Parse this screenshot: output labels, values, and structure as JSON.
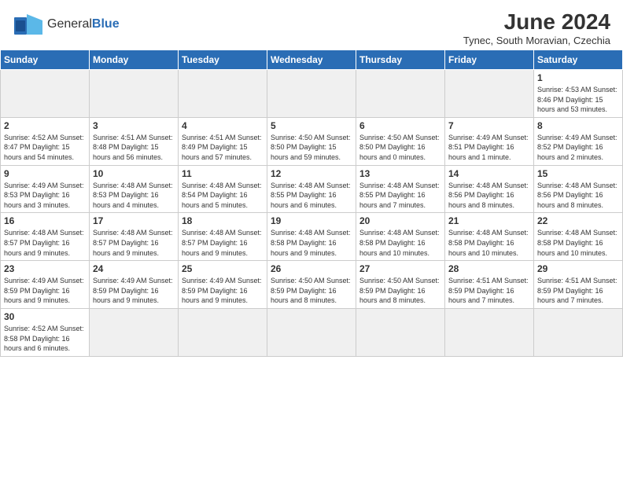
{
  "header": {
    "month_title": "June 2024",
    "location": "Tynec, South Moravian, Czechia",
    "logo_general": "General",
    "logo_blue": "Blue"
  },
  "days_of_week": [
    "Sunday",
    "Monday",
    "Tuesday",
    "Wednesday",
    "Thursday",
    "Friday",
    "Saturday"
  ],
  "weeks": [
    [
      {
        "day": "",
        "info": "",
        "empty": true
      },
      {
        "day": "",
        "info": "",
        "empty": true
      },
      {
        "day": "",
        "info": "",
        "empty": true
      },
      {
        "day": "",
        "info": "",
        "empty": true
      },
      {
        "day": "",
        "info": "",
        "empty": true
      },
      {
        "day": "",
        "info": "",
        "empty": true
      },
      {
        "day": "1",
        "info": "Sunrise: 4:53 AM\nSunset: 8:46 PM\nDaylight: 15 hours and 53 minutes."
      }
    ],
    [
      {
        "day": "2",
        "info": "Sunrise: 4:52 AM\nSunset: 8:47 PM\nDaylight: 15 hours and 54 minutes."
      },
      {
        "day": "3",
        "info": "Sunrise: 4:51 AM\nSunset: 8:48 PM\nDaylight: 15 hours and 56 minutes."
      },
      {
        "day": "4",
        "info": "Sunrise: 4:51 AM\nSunset: 8:49 PM\nDaylight: 15 hours and 57 minutes."
      },
      {
        "day": "5",
        "info": "Sunrise: 4:50 AM\nSunset: 8:50 PM\nDaylight: 15 hours and 59 minutes."
      },
      {
        "day": "6",
        "info": "Sunrise: 4:50 AM\nSunset: 8:50 PM\nDaylight: 16 hours and 0 minutes."
      },
      {
        "day": "7",
        "info": "Sunrise: 4:49 AM\nSunset: 8:51 PM\nDaylight: 16 hours and 1 minute."
      },
      {
        "day": "8",
        "info": "Sunrise: 4:49 AM\nSunset: 8:52 PM\nDaylight: 16 hours and 2 minutes."
      }
    ],
    [
      {
        "day": "9",
        "info": "Sunrise: 4:49 AM\nSunset: 8:53 PM\nDaylight: 16 hours and 3 minutes."
      },
      {
        "day": "10",
        "info": "Sunrise: 4:48 AM\nSunset: 8:53 PM\nDaylight: 16 hours and 4 minutes."
      },
      {
        "day": "11",
        "info": "Sunrise: 4:48 AM\nSunset: 8:54 PM\nDaylight: 16 hours and 5 minutes."
      },
      {
        "day": "12",
        "info": "Sunrise: 4:48 AM\nSunset: 8:55 PM\nDaylight: 16 hours and 6 minutes."
      },
      {
        "day": "13",
        "info": "Sunrise: 4:48 AM\nSunset: 8:55 PM\nDaylight: 16 hours and 7 minutes."
      },
      {
        "day": "14",
        "info": "Sunrise: 4:48 AM\nSunset: 8:56 PM\nDaylight: 16 hours and 8 minutes."
      },
      {
        "day": "15",
        "info": "Sunrise: 4:48 AM\nSunset: 8:56 PM\nDaylight: 16 hours and 8 minutes."
      }
    ],
    [
      {
        "day": "16",
        "info": "Sunrise: 4:48 AM\nSunset: 8:57 PM\nDaylight: 16 hours and 9 minutes."
      },
      {
        "day": "17",
        "info": "Sunrise: 4:48 AM\nSunset: 8:57 PM\nDaylight: 16 hours and 9 minutes."
      },
      {
        "day": "18",
        "info": "Sunrise: 4:48 AM\nSunset: 8:57 PM\nDaylight: 16 hours and 9 minutes."
      },
      {
        "day": "19",
        "info": "Sunrise: 4:48 AM\nSunset: 8:58 PM\nDaylight: 16 hours and 9 minutes."
      },
      {
        "day": "20",
        "info": "Sunrise: 4:48 AM\nSunset: 8:58 PM\nDaylight: 16 hours and 10 minutes."
      },
      {
        "day": "21",
        "info": "Sunrise: 4:48 AM\nSunset: 8:58 PM\nDaylight: 16 hours and 10 minutes."
      },
      {
        "day": "22",
        "info": "Sunrise: 4:48 AM\nSunset: 8:58 PM\nDaylight: 16 hours and 10 minutes."
      }
    ],
    [
      {
        "day": "23",
        "info": "Sunrise: 4:49 AM\nSunset: 8:59 PM\nDaylight: 16 hours and 9 minutes."
      },
      {
        "day": "24",
        "info": "Sunrise: 4:49 AM\nSunset: 8:59 PM\nDaylight: 16 hours and 9 minutes."
      },
      {
        "day": "25",
        "info": "Sunrise: 4:49 AM\nSunset: 8:59 PM\nDaylight: 16 hours and 9 minutes."
      },
      {
        "day": "26",
        "info": "Sunrise: 4:50 AM\nSunset: 8:59 PM\nDaylight: 16 hours and 8 minutes."
      },
      {
        "day": "27",
        "info": "Sunrise: 4:50 AM\nSunset: 8:59 PM\nDaylight: 16 hours and 8 minutes."
      },
      {
        "day": "28",
        "info": "Sunrise: 4:51 AM\nSunset: 8:59 PM\nDaylight: 16 hours and 7 minutes."
      },
      {
        "day": "29",
        "info": "Sunrise: 4:51 AM\nSunset: 8:59 PM\nDaylight: 16 hours and 7 minutes."
      }
    ],
    [
      {
        "day": "30",
        "info": "Sunrise: 4:52 AM\nSunset: 8:58 PM\nDaylight: 16 hours and 6 minutes."
      },
      {
        "day": "",
        "info": "",
        "empty": true
      },
      {
        "day": "",
        "info": "",
        "empty": true
      },
      {
        "day": "",
        "info": "",
        "empty": true
      },
      {
        "day": "",
        "info": "",
        "empty": true
      },
      {
        "day": "",
        "info": "",
        "empty": true
      },
      {
        "day": "",
        "info": "",
        "empty": true
      }
    ]
  ]
}
